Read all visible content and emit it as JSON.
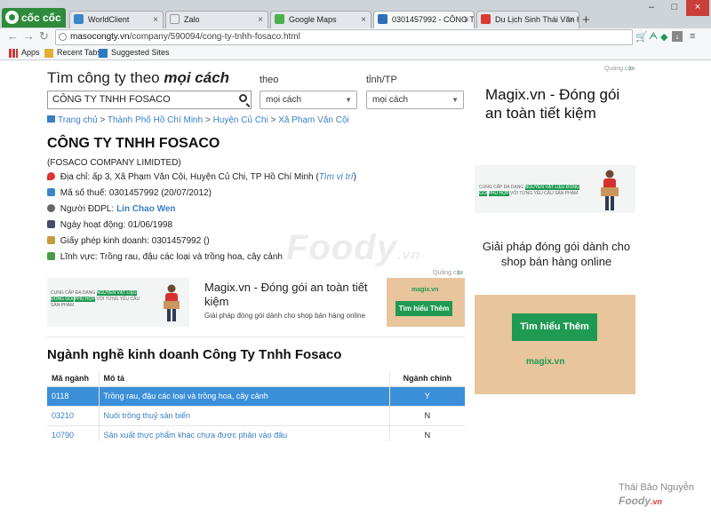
{
  "browser": {
    "brand": "cốc cốc",
    "tabs": [
      {
        "title": "WorldClient"
      },
      {
        "title": "Zalo"
      },
      {
        "title": "Google Maps"
      },
      {
        "title": "0301457992 - CÔNG TY T"
      },
      {
        "title": "Du Lịch Sinh Thái Văn Hòa"
      }
    ],
    "url_domain": "masocongty.vn",
    "url_path": "/company/590094/cong-ty-tnhh-fosaco.html",
    "bookmarks": [
      "Apps",
      "Recent Tabs",
      "Suggested Sites"
    ]
  },
  "search": {
    "heading_prefix": "Tìm công ty theo",
    "heading_emph": "mọi cách",
    "theo_label": "theo",
    "tinh_label": "tỉnh/TP",
    "query": "CÔNG TY TNHH FOSACO",
    "theo_value": "mọi cách",
    "tinh_value": "mọi cách"
  },
  "breadcrumb": [
    "Trang chủ",
    "Thành Phố Hồ Chí Minh",
    "Huyện Củ Chi",
    "Xã Phạm Văn Cội"
  ],
  "company": {
    "name": "CÔNG TY TNHH FOSACO",
    "english_name": "(FOSACO COMPANY LIMIDTED)",
    "address_label": "Địa chỉ:",
    "address": "ấp 3, Xã Phạm Văn Cội, Huyện Củ Chi, TP Hồ Chí Minh",
    "address_link": "Tìm vị trí",
    "tax_label": "Mã số thuế:",
    "tax": "0301457992 (20/07/2012)",
    "rep_label": "Người ĐDPL:",
    "rep": "Lin Chao Wen",
    "start_label": "Ngày hoạt động:",
    "start": "01/06/1998",
    "license_label": "Giấy phép kinh doanh:",
    "license": "0301457992 ()",
    "field_label": "Lĩnh vực:",
    "field": "Trồng rau, đậu các loại và trồng hoa, cây cảnh"
  },
  "watermark": {
    "main": "Foody",
    "suffix": ".vn"
  },
  "ad_inline": {
    "label": "Quảng cáo",
    "title": "Magix.vn - Đóng gói an toàn tiết kiệm",
    "subtitle": "Giải pháp đóng gói dành cho shop bán hàng online",
    "button": "Tìm hiểu Thêm",
    "brand": "magix.vn",
    "pic_text_1": "CUNG CẤP ĐA DẠNG",
    "pic_text_hl": "NGUYÊN VẬT LIỆU ĐÓNG GÓI",
    "pic_text_2": "PHÙ HỢP",
    "pic_text_3": "VỚI TỪNG YÊU CẦU SẢN PHẨM"
  },
  "ad_side": {
    "label": "Quảng cáo",
    "title": "Magix.vn - Đóng gói an toàn tiết kiệm",
    "desc": "Giải pháp đóng gói dành cho shop bán hàng online",
    "button": "Tìm hiểu Thêm",
    "brand": "magix.vn"
  },
  "business": {
    "title": "Ngành nghề kinh doanh Công Ty Tnhh Fosaco",
    "headers": [
      "Mã ngành",
      "Mô tả",
      "Ngành chính"
    ],
    "rows": [
      {
        "code": "0118",
        "desc": "Trồng rau, đậu các loại và trồng hoa, cây cảnh",
        "main": "Y"
      },
      {
        "code": "03210",
        "desc": "Nuôi trồng thuỷ sản biển",
        "main": "N"
      },
      {
        "code": "10790",
        "desc": "Sản xuất thực phẩm khác chưa được phân vào đâu",
        "main": "N"
      }
    ]
  },
  "credit": {
    "author": "Thái Bảo Nguyễn",
    "site": "Foody",
    "site_suffix": ".vn"
  },
  "colors": {
    "accent": "#3a7fc4",
    "selected_row": "#3b8fd9",
    "ad_green": "#1f9a52",
    "box": "#e8c59c"
  }
}
